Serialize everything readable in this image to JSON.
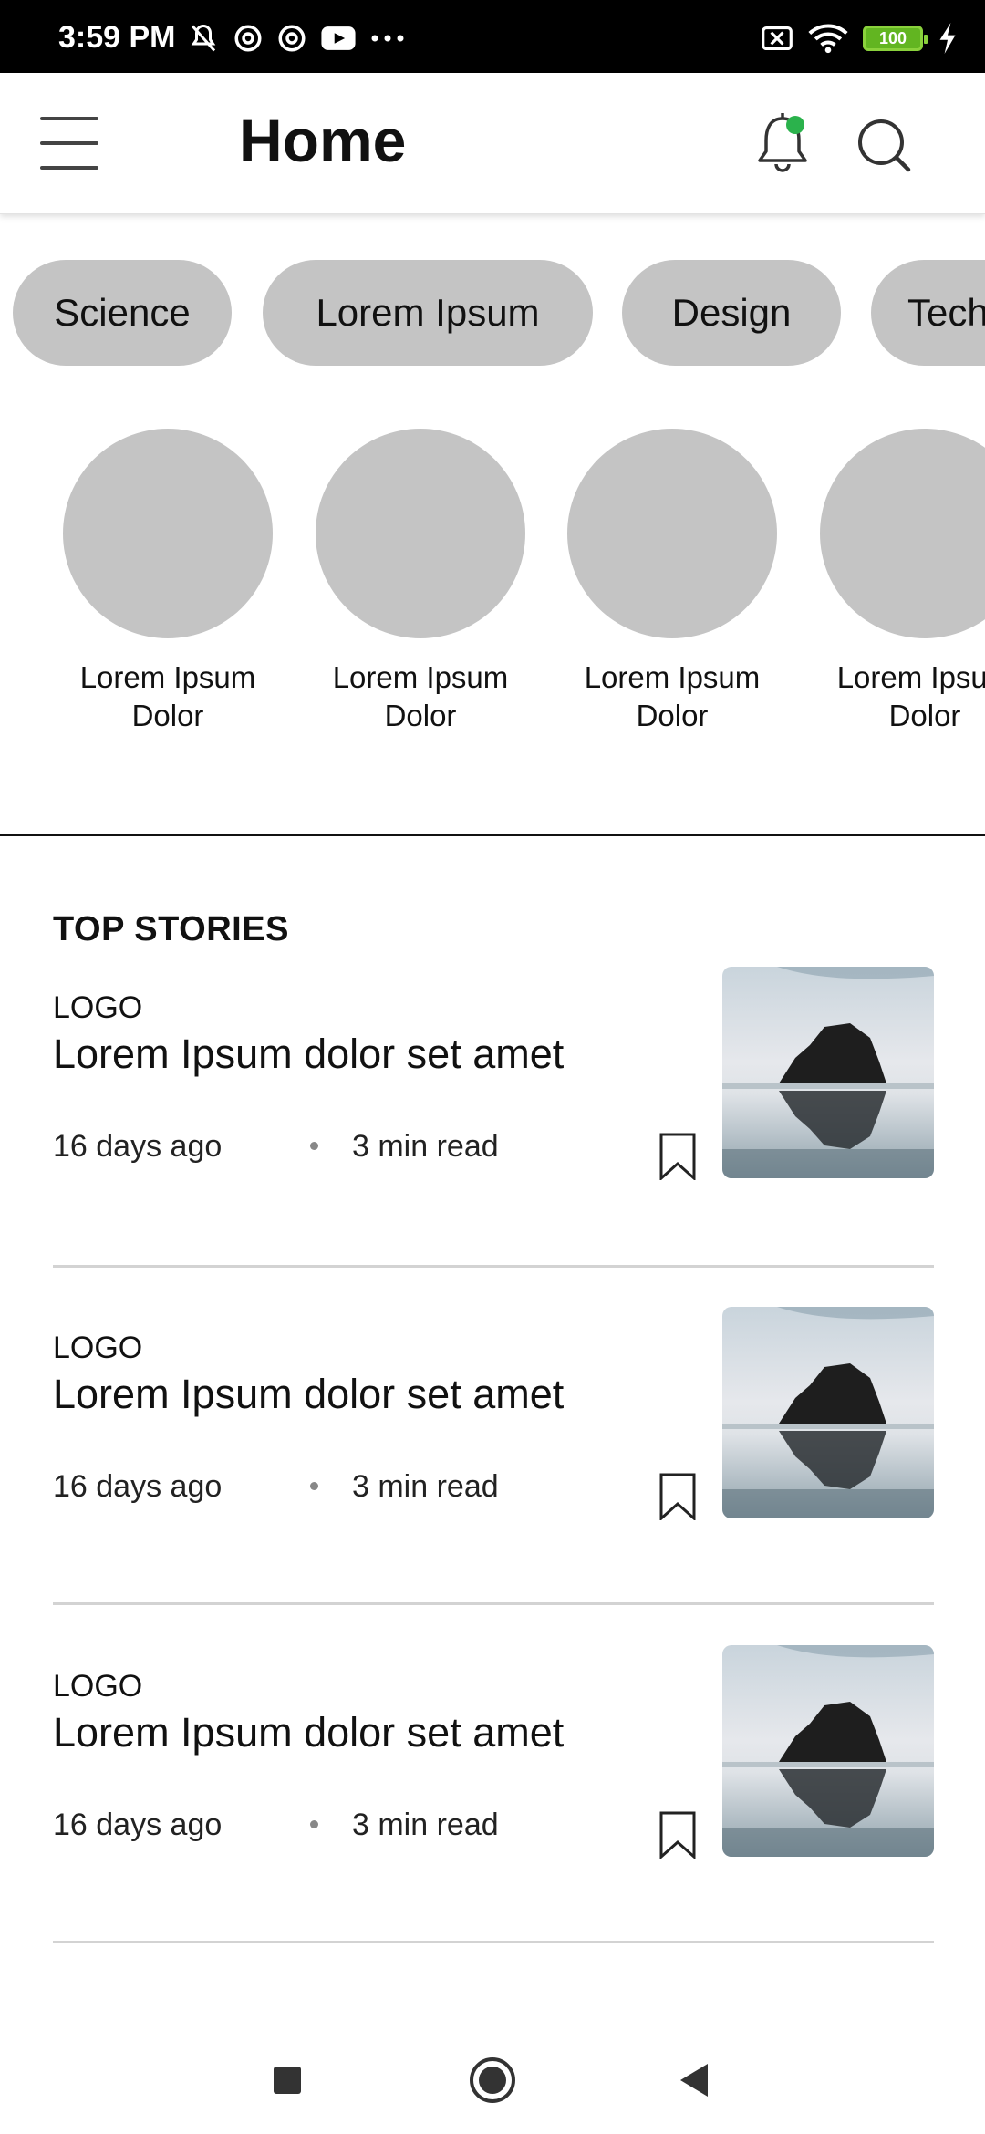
{
  "status_bar": {
    "time": "3:59 PM",
    "battery_level": "100",
    "icons_left": [
      "bell-off-icon",
      "at-sign-icon",
      "at-sign-icon",
      "youtube-icon",
      "more-dots-icon"
    ],
    "icons_right": [
      "sim-off-icon",
      "wifi-icon",
      "battery-icon",
      "charging-icon"
    ]
  },
  "header": {
    "title": "Home",
    "notification_dot_color": "#2bb24c"
  },
  "categories": [
    "Science",
    "Lorem Ipsum",
    "Design",
    "Tech"
  ],
  "circles": [
    {
      "line1": "Lorem Ipsum",
      "line2": "Dolor"
    },
    {
      "line1": "Lorem Ipsum",
      "line2": "Dolor"
    },
    {
      "line1": "Lorem Ipsum",
      "line2": "Dolor"
    },
    {
      "line1": "Lorem Ipsum",
      "line2": "Dolor"
    }
  ],
  "top_stories": {
    "heading": "TOP STORIES",
    "items": [
      {
        "logo": "LOGO",
        "title": "Lorem Ipsum dolor set amet",
        "date": "16 days ago",
        "read_time": "3 min read"
      },
      {
        "logo": "LOGO",
        "title": "Lorem Ipsum dolor set amet",
        "date": "16 days ago",
        "read_time": "3 min read"
      },
      {
        "logo": "LOGO",
        "title": "Lorem Ipsum dolor set amet",
        "date": "16 days ago",
        "read_time": "3 min read"
      }
    ]
  },
  "colors": {
    "chip_bg": "#c4c4c4",
    "divider": "#111111",
    "separator": "#d3d3d3",
    "notification_dot": "#2bb24c"
  }
}
